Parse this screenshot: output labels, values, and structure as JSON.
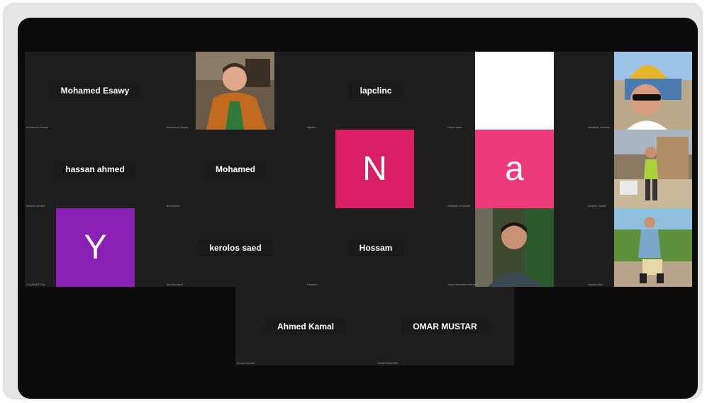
{
  "participants": {
    "mohamed_esawy": {
      "display": "Mohamed Esawy",
      "label": "Mohamed Esawy"
    },
    "mahmoud_swaily": {
      "label": "Mahmoud Swaily"
    },
    "lapclinc": {
      "display": "lapclinc",
      "label": "lapclinc"
    },
    "omar_saad": {
      "label": "Omar Saad"
    },
    "abdallah_jordany": {
      "label": "Abdallah Jordany"
    },
    "hassan_ahmed": {
      "display": "hassan ahmed",
      "label": "hassan ahmed"
    },
    "mohamed": {
      "display": "Mohamed",
      "label": "Mohamed"
    },
    "n_user": {
      "initial": "N"
    },
    "a_user": {
      "initial": "a",
      "label": "Abdallah Khashab"
    },
    "ibrahim_tawfik": {
      "label": "Ibrahim Tawfik"
    },
    "youssef": {
      "initial": "Y",
      "label": "YOUSSEF Eid"
    },
    "kerolos_saed": {
      "display": "kerolos saed",
      "label": "kerolos saed"
    },
    "hossam": {
      "display": "Hossam",
      "label": "Hossam"
    },
    "yasin": {
      "label": "Yasin Mohamed Ahmed"
    },
    "samah": {
      "label": "Samah Atta"
    },
    "ahmed_kamal": {
      "display": "Ahmed Kamal",
      "label": "Ahmed Kamal"
    },
    "omar_mustar": {
      "display": "OMAR MUSTAR",
      "label": "OMAR MUSTAR"
    }
  },
  "colors": {
    "tile_bg": "#1e1e1e",
    "screen_bg": "#0b0b0b",
    "avatar_n": "#d91e63",
    "avatar_a": "#ee3a7a",
    "avatar_y": "#8a1fb3"
  },
  "icons": {
    "mahmoud_swaily": "person-photo",
    "omar_saad": "blank-white-video",
    "abdallah_jordany": "person-photo",
    "ibrahim_tawfik": "person-photo",
    "yasin": "person-photo",
    "samah": "person-photo"
  }
}
